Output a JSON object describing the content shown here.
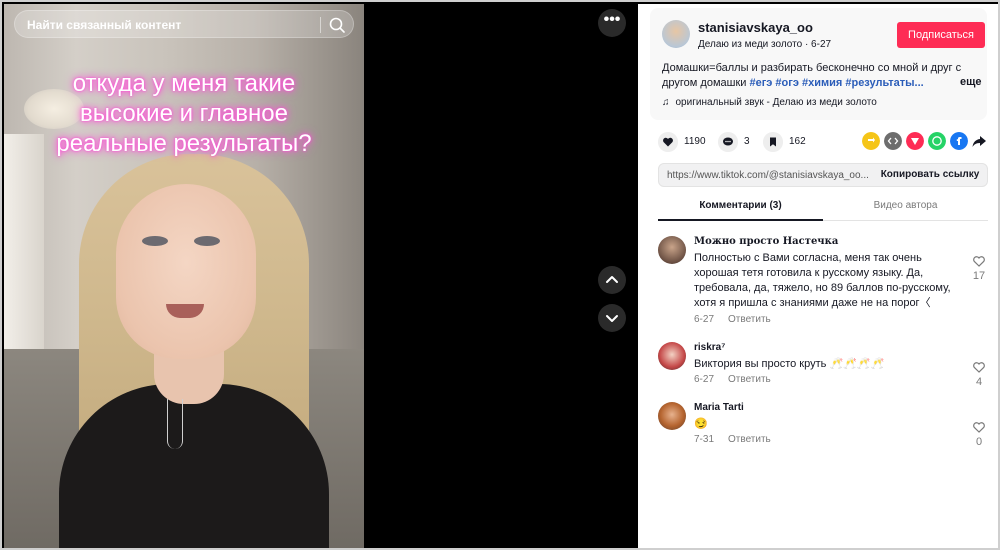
{
  "video": {
    "search_placeholder": "Найти связанный контент",
    "overlay_line1": "откуда у меня такие",
    "overlay_line2": "высокие и главное",
    "overlay_line3": "реальные результаты?",
    "more_label": "•••"
  },
  "author": {
    "username": "stanisiavskaya_oo",
    "subtitle": "Делаю из меди золото · 6-27",
    "follow_label": "Подписаться",
    "description_text": "Домашки=баллы и разбирать бесконечно со мной и друг с другом домашки",
    "description_tags": "#егэ #огэ #химия #результаты...",
    "more_label": "еще",
    "sound": "оригинальный звук - Делаю из меди золото"
  },
  "actions": {
    "likes": "1190",
    "comments": "3",
    "saves": "162"
  },
  "link": {
    "url": "https://www.tiktok.com/@stanisiavskaya_oo...",
    "copy_label": "Копировать ссылку"
  },
  "tabs": {
    "comments": "Комментарии (3)",
    "author_videos": "Видео автора"
  },
  "comments": [
    {
      "name": "Можно просто Настечка",
      "text": "Полностью с Вами согласна, меня так очень хорошая тетя готовила к русскому языку. Да, требовала, да, тяжело, но 89 баллов по-русскому, хотя я пришла с знаниями даже не на порог〈",
      "date": "6-27",
      "reply": "Ответить",
      "likes": "17"
    },
    {
      "name": "riskra⁷",
      "text": "Виктория вы просто круть 🥂🥂🥂🥂",
      "date": "6-27",
      "reply": "Ответить",
      "likes": "4"
    },
    {
      "name": "Maria Tarti",
      "text": "😏",
      "date": "7-31",
      "reply": "Ответить",
      "likes": "0"
    }
  ],
  "colors": {
    "accent": "#fe2c55",
    "hashtag": "#2b5db9",
    "overlay_glow": "#ff4fd8"
  }
}
